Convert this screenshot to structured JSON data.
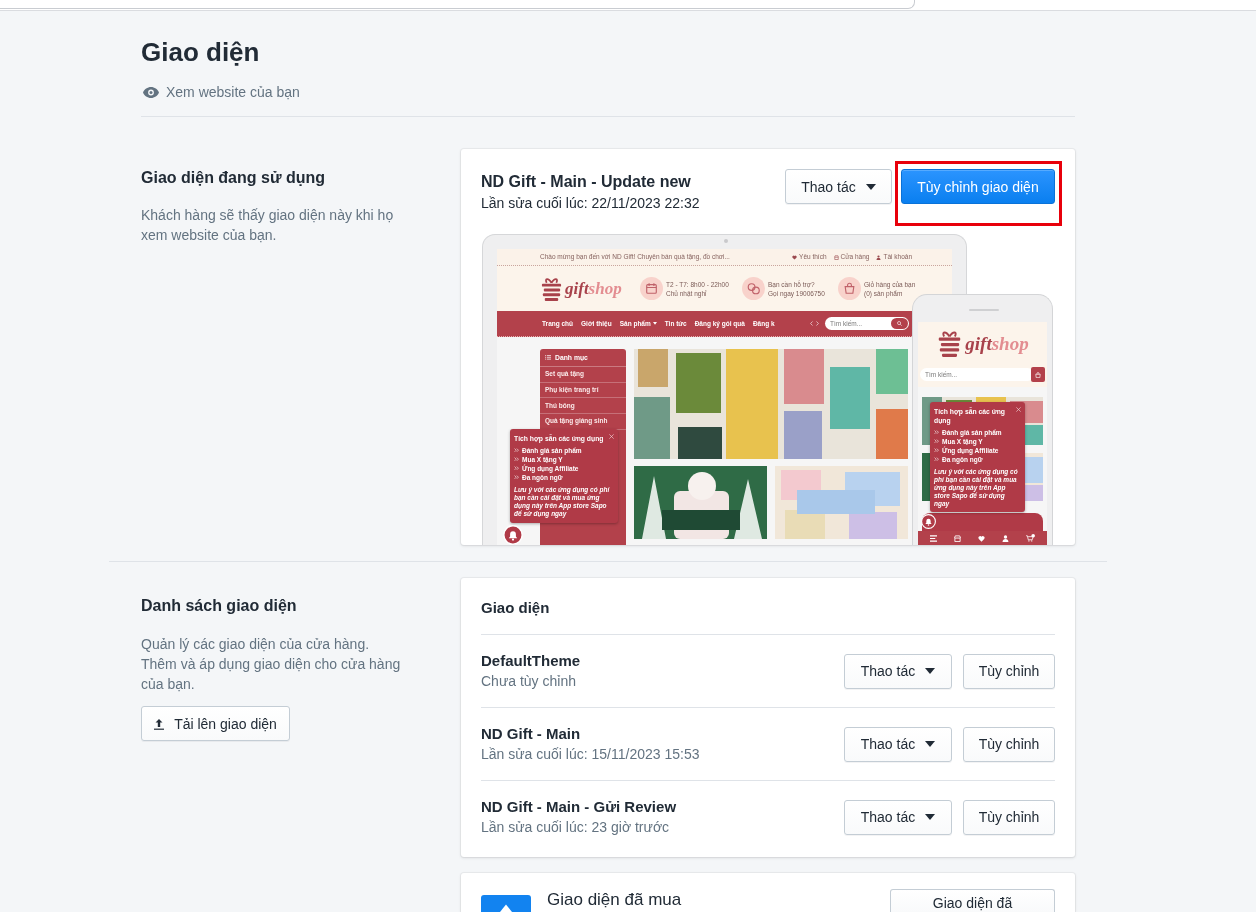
{
  "page": {
    "title": "Giao diện",
    "view_link": "Xem website của bạn"
  },
  "current_theme": {
    "heading": "Giao diện đang sử dụng",
    "description": "Khách hàng sẽ thấy giao diện này khi họ xem website của bạn.",
    "theme": {
      "name": "ND Gift - Main - Update new",
      "edited": "Lần sửa cuối lúc: 22/11/2023 22:32"
    },
    "buttons": [
      {
        "label": "Thao tác",
        "kind": "dropdown",
        "highlighted": false
      },
      {
        "label": "Tùy chỉnh giao diện",
        "kind": "primary",
        "highlighted": true
      }
    ],
    "preview": {
      "desktop": {
        "welcome": "Chào mừng bạn đến với ND Gift! Chuyên bán quà tặng, đồ chơi...",
        "top_links": [
          "Yêu thích",
          "Cửa hàng",
          "Tài khoản"
        ],
        "logo": {
          "first": "gift",
          "second": "shop"
        },
        "info": [
          {
            "line1": "T2 - T7: 8h00 - 22h00",
            "line2": "Chủ nhật nghỉ"
          },
          {
            "line1": "Bạn cần hỗ trợ?",
            "line2": "Gọi ngay 19006750"
          },
          {
            "line1": "Giỏ hàng của bạn",
            "line2": "(0) sản phẩm"
          }
        ],
        "nav": [
          {
            "label": "Trang chủ",
            "dropdown": false
          },
          {
            "label": "Giới thiệu",
            "dropdown": false
          },
          {
            "label": "Sản phẩm",
            "dropdown": true
          },
          {
            "label": "Tin tức",
            "dropdown": false
          },
          {
            "label": "Đăng ký gói quà",
            "dropdown": false
          },
          {
            "label": "Đăng k",
            "dropdown": false
          }
        ],
        "search": {
          "placeholder": "Tìm kiếm..."
        },
        "categories": {
          "title": "Danh mục",
          "items": [
            "Set quà tặng",
            "Phụ kiện trang trí",
            "Thú bông",
            "Quà tặng giáng sinh"
          ]
        },
        "popup": {
          "title": "Tích hợp sẵn các ứng dụng",
          "items": [
            "Đánh giá sản phẩm",
            "Mua X tặng Y",
            "Ứng dụng Affiliate",
            "Đa ngôn ngữ"
          ],
          "note": "Lưu ý với các ứng dụng có phí bạn cần cài đặt và mua ứng dụng này trên App store Sapo để sử dụng ngay"
        }
      },
      "mobile": {
        "logo": {
          "first": "gift",
          "second": "shop"
        },
        "search": {
          "placeholder": "Tìm kiếm..."
        },
        "popup": {
          "title": "Tích hợp sẵn các ứng dụng",
          "items": [
            "Đánh giá sản phẩm",
            "Mua X tặng Y",
            "Ứng dụng Affiliate",
            "Đa ngôn ngữ"
          ],
          "note": "Lưu ý với các ứng dụng có phí bạn cần cài đặt và mua ứng dụng này trên App store Sapo để sử dụng ngay"
        }
      }
    }
  },
  "theme_list": {
    "heading": "Danh sách giao diện",
    "description": [
      "Quản lý các giao diện của cửa hàng.",
      "Thêm và áp dụng giao diện cho cửa hàng của bạn."
    ],
    "upload_button": "Tải lên giao diện",
    "card_title": "Giao diện",
    "themes": [
      {
        "name": "DefaultTheme",
        "status": "Chưa tùy chỉnh",
        "buttons": [
          {
            "label": "Thao tác",
            "kind": "dropdown"
          },
          {
            "label": "Tùy chỉnh",
            "kind": "default"
          }
        ]
      },
      {
        "name": "ND Gift - Main",
        "status": "Lần sửa cuối lúc: 15/11/2023 15:53",
        "buttons": [
          {
            "label": "Thao tác",
            "kind": "dropdown"
          },
          {
            "label": "Tùy chỉnh",
            "kind": "default"
          }
        ]
      },
      {
        "name": "ND Gift - Main - Gửi Review",
        "status": "Lần sửa cuối lúc: 23 giờ trước",
        "buttons": [
          {
            "label": "Thao tác",
            "kind": "dropdown"
          },
          {
            "label": "Tùy chỉnh",
            "kind": "default"
          }
        ]
      }
    ]
  },
  "purchased": {
    "title": "Giao diện đã mua",
    "button": "Giao diện đã"
  }
}
